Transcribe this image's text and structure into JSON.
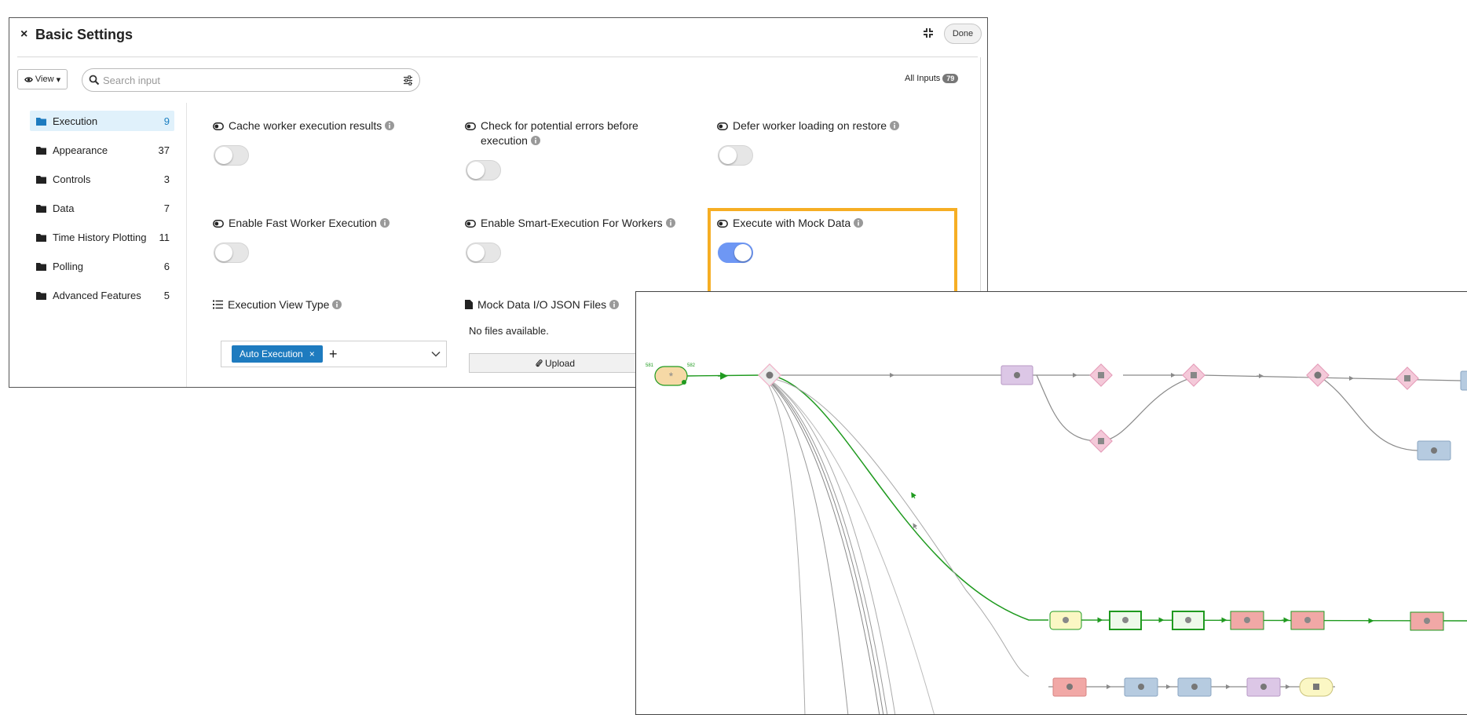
{
  "dialog": {
    "title": "Basic Settings",
    "close_glyph": "×",
    "done_label": "Done"
  },
  "toolbar": {
    "view_label": "View",
    "view_caret": "▾",
    "search_placeholder": "Search input",
    "all_inputs_label": "All Inputs",
    "all_inputs_count": "79"
  },
  "categories": [
    {
      "label": "Execution",
      "count": "9",
      "active": true
    },
    {
      "label": "Appearance",
      "count": "37"
    },
    {
      "label": "Controls",
      "count": "3"
    },
    {
      "label": "Data",
      "count": "7"
    },
    {
      "label": "Time History Plotting",
      "count": "11"
    },
    {
      "label": "Polling",
      "count": "6"
    },
    {
      "label": "Advanced Features",
      "count": "5"
    }
  ],
  "settings": [
    {
      "label": "Cache worker execution results",
      "enabled": false
    },
    {
      "label": "Check for potential errors before execution",
      "enabled": false
    },
    {
      "label": "Defer worker loading on restore",
      "enabled": false
    },
    {
      "label": "Enable Fast Worker Execution",
      "enabled": false
    },
    {
      "label": "Enable Smart-Execution For Workers",
      "enabled": false
    },
    {
      "label": "Execute with Mock Data",
      "enabled": true,
      "highlighted": true
    }
  ],
  "execution_view": {
    "label": "Execution View Type",
    "selected": "Auto Execution",
    "chip_remove": "×",
    "add_glyph": "+"
  },
  "mock_files": {
    "label": "Mock Data I/O JSON Files",
    "empty_text": "No files available.",
    "upload_label": "Upload"
  },
  "workflow": {
    "start_node_left_label": "581",
    "start_node_right_label": "582",
    "colors": {
      "active_edge": "#1f9a1f",
      "edge": "#8a8a8a",
      "purple": "#dcc7e6",
      "pink": "#f4c9d9",
      "blue": "#b6cbe0",
      "yellow": "#fbf7c4",
      "green_node": "#eef9ea",
      "red": "#f1a8a6",
      "start": "#f6d9a6"
    }
  },
  "colors": {
    "accent_blue": "#1e7bbf",
    "toggle_on": "#6e97f4",
    "highlight": "#f6ae24"
  }
}
